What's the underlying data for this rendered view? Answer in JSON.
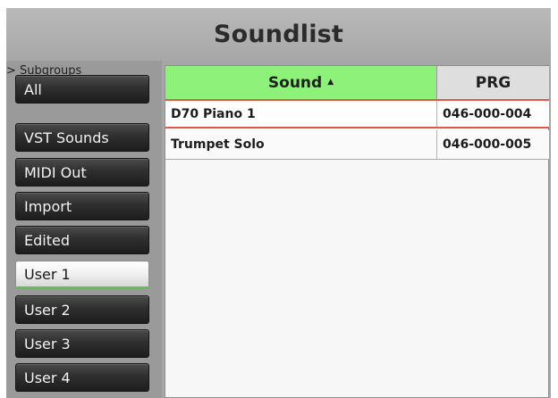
{
  "header": {
    "title": "Soundlist"
  },
  "sidebar": {
    "label": "> Subgroups",
    "items": [
      {
        "label": "All",
        "active": false
      },
      {
        "label": "VST Sounds",
        "active": false
      },
      {
        "label": "MIDI Out",
        "active": false
      },
      {
        "label": "Import",
        "active": false
      },
      {
        "label": "Edited",
        "active": false
      },
      {
        "label": "User 1",
        "active": true
      },
      {
        "label": "User 2",
        "active": false
      },
      {
        "label": "User 3",
        "active": false
      },
      {
        "label": "User 4",
        "active": false
      }
    ]
  },
  "table": {
    "columns": [
      {
        "label": "Sound",
        "sort": "ascending"
      },
      {
        "label": "PRG"
      }
    ],
    "sort_arrow": "▲",
    "rows": [
      {
        "sound": "D70 Piano 1",
        "prg": "046-000-004",
        "selected": true
      },
      {
        "sound": "Trumpet Solo",
        "prg": "046-000-005",
        "selected": false
      }
    ]
  },
  "colors": {
    "header_bg": "#b1b1b1",
    "sidebar_bg": "#9a9a9a",
    "sound_column_header": "#8ef27a",
    "selection_border": "#e4574f",
    "active_underline": "#5fbf4f"
  }
}
